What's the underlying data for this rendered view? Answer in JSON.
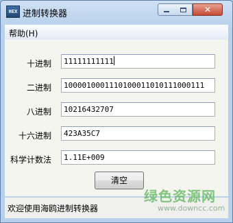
{
  "window": {
    "title": "进制转换器",
    "icon_text": "HEX",
    "controls": {
      "minimize": "minimize-icon",
      "maximize": "maximize-icon",
      "close": "close-icon"
    }
  },
  "menu": {
    "help": "帮助(H)"
  },
  "converter": {
    "decimal_label": "十进制",
    "decimal_value": "11111111111",
    "binary_label": "二进制",
    "binary_value": "1000010001110100011010111000111",
    "octal_label": "八进制",
    "octal_value": "10216432707",
    "hex_label": "十六进制",
    "hex_value": "423A35C7",
    "scientific_label": "科学计数法",
    "scientific_value": "1.11E+009",
    "clear_button": "清空"
  },
  "status": {
    "text": "欢迎使用海鸥进制转换器"
  },
  "watermark": {
    "brand": "绿色资源网",
    "url": "www.downcc.com"
  }
}
